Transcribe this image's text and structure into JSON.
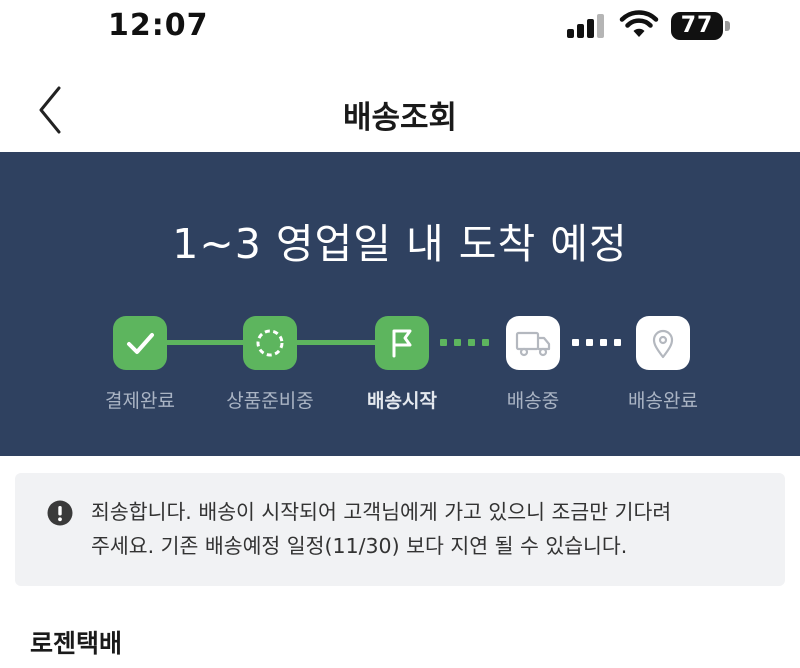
{
  "status_bar": {
    "time": "12:07",
    "battery": "77",
    "icons": [
      "cellular-signal-icon",
      "wifi-icon",
      "battery-icon"
    ]
  },
  "header": {
    "title": "배송조회",
    "back_icon": "chevron-left-icon"
  },
  "hero": {
    "title": "1~3 영업일 내 도착 예정",
    "background": "#2f4160",
    "steps": [
      {
        "label": "결제완료",
        "state": "done",
        "icon": "check-icon"
      },
      {
        "label": "상품준비중",
        "state": "done",
        "icon": "dashed-circle-icon"
      },
      {
        "label": "배송시작",
        "state": "current",
        "icon": "flag-icon"
      },
      {
        "label": "배송중",
        "state": "todo",
        "icon": "truck-icon"
      },
      {
        "label": "배송완료",
        "state": "todo",
        "icon": "location-pin-icon"
      }
    ]
  },
  "notice": {
    "icon": "exclamation-circle-icon",
    "line1": "죄송합니다. 배송이 시작되어 고객님에게 가고 있으니 조금만 기다려",
    "line2": "주세요. 기존 배송예정 일정(11/30) 보다 지연 될 수 있습니다."
  },
  "courier": {
    "name": "로젠택배"
  },
  "colors": {
    "accent_green": "#5db55e",
    "banner_navy": "#2f4160",
    "notice_bg": "#f1f2f4"
  }
}
